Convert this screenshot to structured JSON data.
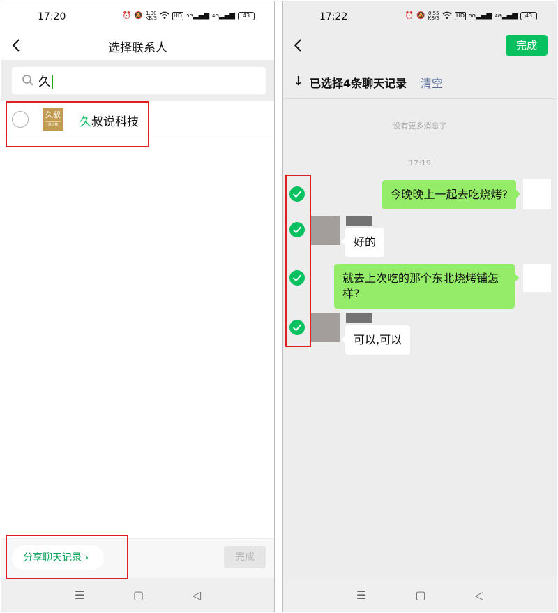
{
  "left": {
    "status": {
      "time": "17:20",
      "net_speed": "1.00",
      "net_unit": "KB/S",
      "hd": "HD",
      "sig1": "5G",
      "sig2": "4G",
      "battery": "43"
    },
    "title": "选择联系人",
    "search": {
      "query": "久"
    },
    "contact": {
      "avatar_top": "久叔",
      "avatar_bottom": "说科技",
      "name_highlight": "久",
      "name_rest": "叔说科技"
    },
    "share_label": "分享聊天记录 ›",
    "done_label": "完成",
    "sysnav": {
      "menu": "☰",
      "home": "▢",
      "back": "◁"
    }
  },
  "right": {
    "status": {
      "time": "17:22",
      "net_speed": "0.55",
      "net_unit": "KB/S",
      "hd": "HD",
      "sig1": "5G",
      "sig2": "4G",
      "battery": "43"
    },
    "done_label": "完成",
    "selection": {
      "arrow": "↓",
      "text": "已选择4条聊天记录",
      "clear": "清空"
    },
    "no_more": "没有更多消息了",
    "timestamp": "17:19",
    "messages": [
      {
        "from": "me",
        "text": "今晚晚上一起去吃烧烤?"
      },
      {
        "from": "other",
        "text": "好的"
      },
      {
        "from": "me",
        "text": "就去上次吃的那个东北烧烤铺怎样?"
      },
      {
        "from": "other",
        "text": "可以,可以"
      }
    ],
    "sysnav": {
      "menu": "☰",
      "home": "▢",
      "back": "◁"
    }
  },
  "colors": {
    "accent": "#07c160",
    "bubble_me": "#95ec69",
    "annotation": "#e02020",
    "link": "#576b95"
  }
}
